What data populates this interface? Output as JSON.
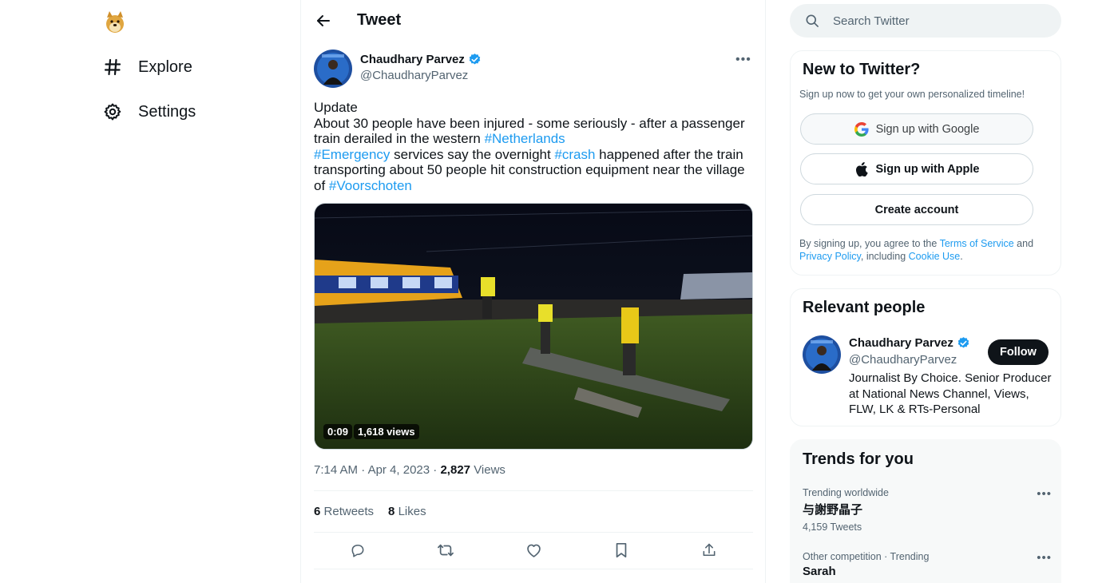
{
  "nav": {
    "logo": "doge-logo",
    "items": [
      {
        "label": "Explore",
        "icon": "hashtag-icon"
      },
      {
        "label": "Settings",
        "icon": "gear-icon"
      }
    ]
  },
  "header": {
    "title": "Tweet",
    "back_icon": "arrow-left-icon"
  },
  "tweet": {
    "author_name": "Chaudhary Parvez",
    "author_handle": "@ChaudharyParvez",
    "verified": true,
    "text": {
      "line1": "Update",
      "p2_before": "About 30 people have been injured - some seriously - after a passenger train derailed in the western ",
      "tag_netherlands": "#Netherlands",
      "tag_emergency": "#Emergency",
      "p3_mid1": " services say the overnight ",
      "tag_crash": "#crash",
      "p3_mid2": " happened after the train transporting about 50 people hit construction equipment near the village of ",
      "tag_voorschoten": "#Voorschoten"
    },
    "media": {
      "duration": "0:09",
      "views": "1,618 views"
    },
    "time": "7:14 AM",
    "date": "Apr 4, 2023",
    "views_count": "2,827",
    "views_label": "Views",
    "retweets_count": "6",
    "retweets_label": "Retweets",
    "likes_count": "8",
    "likes_label": "Likes",
    "actions": [
      "reply-icon",
      "retweet-icon",
      "like-icon",
      "bookmark-icon",
      "share-icon"
    ]
  },
  "search": {
    "placeholder": "Search Twitter"
  },
  "signup": {
    "title": "New to Twitter?",
    "subtitle": "Sign up now to get your own personalized timeline!",
    "google_label": "Sign up with Google",
    "apple_label": "Sign up with Apple",
    "create_label": "Create account",
    "legal_prefix": "By signing up, you agree to the ",
    "terms": "Terms of Service",
    "legal_and": " and ",
    "privacy": "Privacy Policy",
    "legal_including": ", including ",
    "cookie": "Cookie Use",
    "legal_end": "."
  },
  "relevant": {
    "title": "Relevant people",
    "name": "Chaudhary Parvez",
    "handle": "@ChaudharyParvez",
    "bio": "Journalist By Choice. Senior Producer at National News Channel, Views, FLW, LK & RTs-Personal",
    "follow_label": "Follow"
  },
  "trends": {
    "title": "Trends for you",
    "items": [
      {
        "context": "Trending worldwide",
        "name": "与謝野晶子",
        "count": "4,159 Tweets"
      },
      {
        "context": "Other competition · Trending",
        "name": "Sarah",
        "count": ""
      }
    ]
  },
  "colors": {
    "accent": "#1d9bf0",
    "text": "#0f1419",
    "muted": "#536471",
    "border": "#eff3f4"
  }
}
